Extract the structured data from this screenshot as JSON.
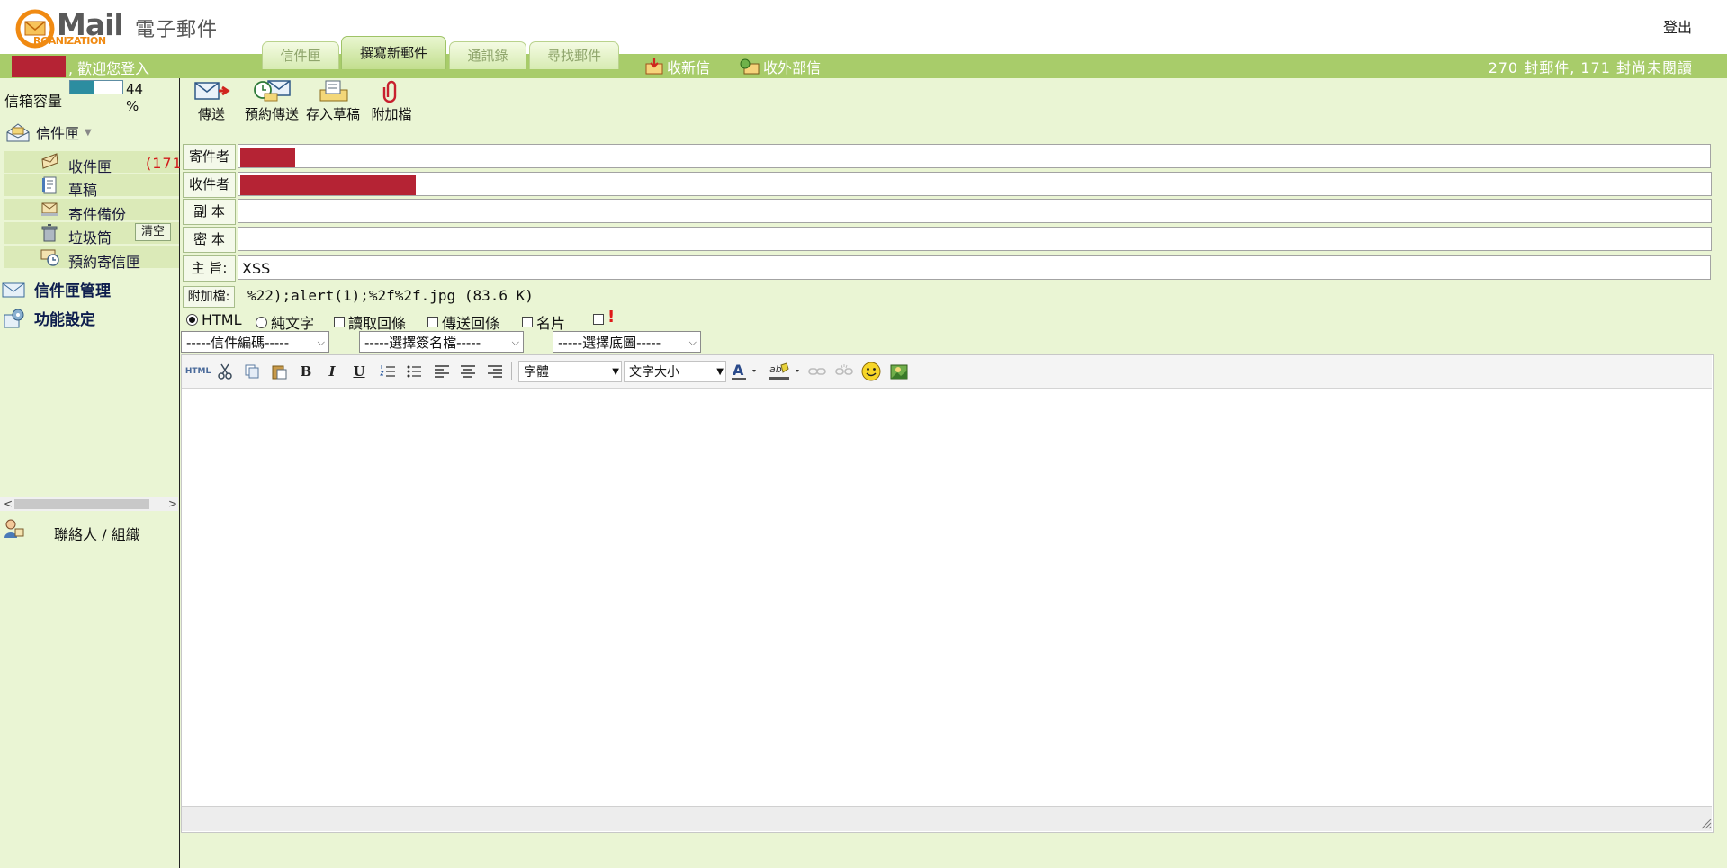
{
  "header": {
    "logo_mail": "Mail",
    "logo_cn": "電子郵件",
    "logo_org": "RGANIZATION",
    "logout": "登出",
    "welcome": ", 歡迎您登入",
    "stats": "270 封郵件, 171 封尚未閱讀",
    "tabs": [
      {
        "label": "信件匣",
        "active": false
      },
      {
        "label": "撰寫新郵件",
        "active": true
      },
      {
        "label": "通訊錄",
        "active": false
      },
      {
        "label": "尋找郵件",
        "active": false
      }
    ],
    "receive_label": "收新信",
    "external_label": "收外部信"
  },
  "sidebar": {
    "quota_label": "信箱容量",
    "quota_percent": 44,
    "quota_pct_text": "44 %",
    "mailbox_head": "信件匣",
    "folders": [
      {
        "label": "收件匣",
        "icon": "inbox-icon"
      },
      {
        "label": "草稿",
        "icon": "draft-icon"
      },
      {
        "label": "寄件備份",
        "icon": "sent-icon"
      },
      {
        "label": "垃圾筒",
        "icon": "trash-icon"
      },
      {
        "label": "預約寄信匣",
        "icon": "scheduled-icon"
      }
    ],
    "inbox_count": "(171",
    "empty_trash": "清空",
    "manage": "信件匣管理",
    "settings": "功能設定",
    "contacts": "聯絡人 / 組織"
  },
  "toolbar": {
    "send": "傳送",
    "schedule": "預約傳送",
    "draft": "存入草稿",
    "attach": "附加檔"
  },
  "form": {
    "from_label": "寄件者",
    "to_label": "收件者",
    "cc_label": "副 本",
    "bcc_label": "密 本",
    "subject_label": "主 旨:",
    "subject_value": "XSS",
    "attach_label": "附加檔:",
    "attach_file": "%22);alert(1);%2f%2f.jpg (83.6 K)"
  },
  "options": {
    "html": "HTML",
    "plain": "純文字",
    "read_receipt": "讀取回條",
    "delivery_receipt": "傳送回條",
    "card": "名片",
    "priority_mark": "!"
  },
  "selects": {
    "encoding": "-----信件編碼-----",
    "signature": "-----選擇簽名檔-----",
    "background": "-----選擇底圖-----"
  },
  "editor": {
    "html_mode": "HTML",
    "font": "字體",
    "size": "文字大小"
  },
  "colors": {
    "green_bar": "#a8cc6a",
    "panel": "#eaf5d4",
    "redaction": "#b52334",
    "count_red": "#d21a1a"
  }
}
